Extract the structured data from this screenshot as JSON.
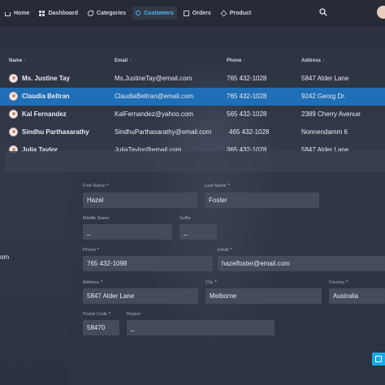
{
  "nav": {
    "items": [
      {
        "label": "Home",
        "icon": "home-icon"
      },
      {
        "label": "Dashboard",
        "icon": "dashboard-icon"
      },
      {
        "label": "Categories",
        "icon": "categories-icon"
      },
      {
        "label": "Customers",
        "icon": "customers-icon",
        "active": true
      },
      {
        "label": "Orders",
        "icon": "orders-icon"
      },
      {
        "label": "Product",
        "icon": "product-icon"
      }
    ],
    "active_color": "#52b8f0"
  },
  "table": {
    "columns": [
      "Name",
      "Email",
      "Phone",
      "Address"
    ],
    "rows": [
      {
        "name": "Ms. Justine Tay",
        "email": "Ms.JustineTay@email.com",
        "phone": "765 432-1028",
        "address": "5847 Alder Lane"
      },
      {
        "name": "Claudia Beltran",
        "email": "ClaudiaBeltran@email.com",
        "phone": "765 432-1028",
        "address": "9242 Georg Dr."
      },
      {
        "name": "Kal Fernandez",
        "email": "KalFernandez@yahoo.com",
        "phone": "565 432-1028",
        "address": "2389 Cherry Avenue"
      },
      {
        "name": "Sindhu Parthasarathy",
        "email": "SindhuParthasarathy@email.com",
        "phone": "465 432-1028",
        "address": "Nonnendamm 6"
      },
      {
        "name": "Julia Taylor",
        "email": "JuliaTaylor@email.com",
        "phone": "365 432-1028",
        "address": "5847 Alder Lane"
      }
    ],
    "selected_index": 1,
    "selected_color": "#1f6eb6"
  },
  "side": {
    "text": "om"
  },
  "form": {
    "first_name": {
      "label": "First Name",
      "value": "Hazel"
    },
    "last_name": {
      "label": "Last Name",
      "value": "Foster"
    },
    "middle_name": {
      "label": "Middle Name",
      "value": "_"
    },
    "suffix": {
      "label": "Suffix",
      "value": "_"
    },
    "phone": {
      "label": "Phone",
      "value": "765 432-1098"
    },
    "email": {
      "label": "Email",
      "value": "hazelfoster@email.com"
    },
    "address": {
      "label": "Address",
      "value": "5847 Alder Lane"
    },
    "city": {
      "label": "City",
      "value": "Melborne"
    },
    "country": {
      "label": "Country",
      "value": "Australia"
    },
    "postal_code": {
      "label": "Postal Code",
      "value": "58470"
    },
    "region": {
      "label": "Region",
      "value": "_"
    },
    "required_mark": "*"
  },
  "actions": {
    "save_icon": "save-icon",
    "save_color": "#1ba8e6"
  }
}
